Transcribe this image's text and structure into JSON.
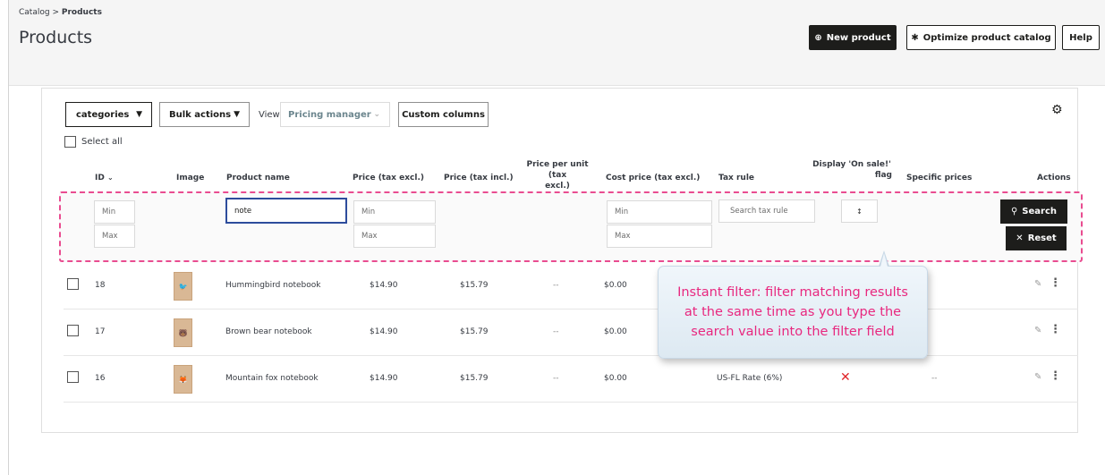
{
  "breadcrumb": {
    "parent": "Catalog",
    "separator": ">",
    "current": "Products"
  },
  "page_title": "Products",
  "header_buttons": {
    "new_product": "New product",
    "optimize": "Optimize product catalog",
    "help": "Help"
  },
  "toolbar": {
    "categories": "categories",
    "bulk_actions": "Bulk actions",
    "view_label": "View",
    "view_value": "Pricing manager",
    "custom_columns": "Custom columns"
  },
  "select_all": "Select all",
  "columns": {
    "id": "ID",
    "image": "Image",
    "product_name": "Product name",
    "price_excl": "Price (tax excl.)",
    "price_incl": "Price (tax incl.)",
    "price_per_unit_1": "Price per unit (tax",
    "price_per_unit_2": "excl.)",
    "cost_price": "Cost price (tax excl.)",
    "tax_rule": "Tax rule",
    "display_onsale_1": "Display 'On sale!'",
    "display_onsale_2": "flag",
    "specific_prices": "Specific prices",
    "actions": "Actions"
  },
  "filters": {
    "id_min": "Min",
    "id_max": "Max",
    "product_name_value": "note",
    "price_min": "Min",
    "price_max": "Max",
    "cost_min": "Min",
    "cost_max": "Max",
    "tax_rule_placeholder": "Search tax rule",
    "onsale_select": "↕",
    "search": "Search",
    "reset": "Reset"
  },
  "rows": [
    {
      "id": "18",
      "name": "Hummingbird notebook",
      "price_excl": "$14.90",
      "price_incl": "$15.79",
      "per_unit": "--",
      "cost": "$0.00",
      "tax_rule": "",
      "onsale": "",
      "specific": ""
    },
    {
      "id": "17",
      "name": "Brown bear notebook",
      "price_excl": "$14.90",
      "price_incl": "$15.79",
      "per_unit": "--",
      "cost": "$0.00",
      "tax_rule": "",
      "onsale": "",
      "specific": ""
    },
    {
      "id": "16",
      "name": "Mountain fox notebook",
      "price_excl": "$14.90",
      "price_incl": "$15.79",
      "per_unit": "--",
      "cost": "$0.00",
      "tax_rule": "US-FL Rate (6%)",
      "onsale": "✕",
      "specific": "--"
    }
  ],
  "tooltip": {
    "line1": "Instant filter: filter matching results",
    "line2": "at the same time as you type the",
    "line3": "search value into the filter field"
  },
  "colors": {
    "accent_pink": "#e8287f",
    "dark_button": "#1d1d1b",
    "danger_red": "#e0262a"
  }
}
